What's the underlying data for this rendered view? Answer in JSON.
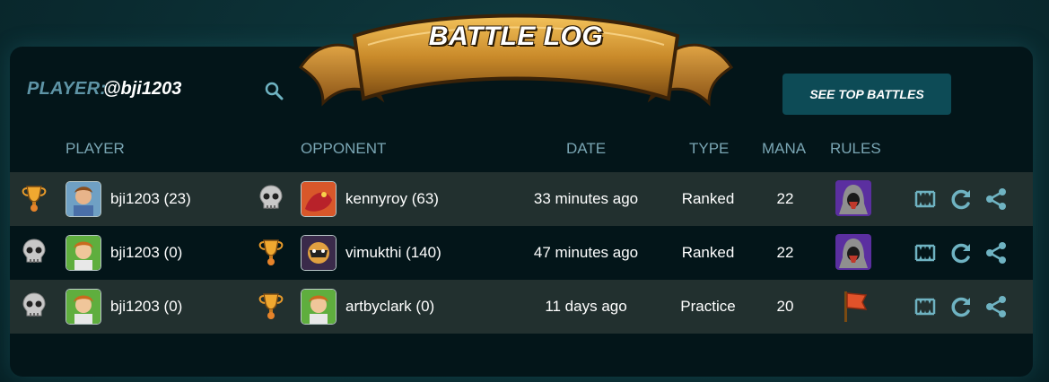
{
  "banner": {
    "title": "BATTLE LOG"
  },
  "player": {
    "label": "PLAYER:",
    "name": "@bji1203"
  },
  "top_battles_button": "SEE TOP BATTLES",
  "columns": {
    "player": "PLAYER",
    "opponent": "OPPONENT",
    "date": "DATE",
    "type": "TYPE",
    "mana": "MANA",
    "rules": "RULES"
  },
  "rows": [
    {
      "player_result": "trophy",
      "player": "bji1203 (23)",
      "opponent_result": "skull",
      "opponent": "kennyroy (63)",
      "date": "33 minutes ago",
      "type": "Ranked",
      "mana": "22",
      "rule_icon": "hooded-figure-icon"
    },
    {
      "player_result": "skull",
      "player": "bji1203 (0)",
      "opponent_result": "trophy",
      "opponent": "vimukthi (140)",
      "date": "47 minutes ago",
      "type": "Ranked",
      "mana": "22",
      "rule_icon": "hooded-figure-icon"
    },
    {
      "player_result": "skull",
      "player": "bji1203 (0)",
      "opponent_result": "trophy",
      "opponent": "artbyclark (0)",
      "date": "11 days ago",
      "type": "Practice",
      "mana": "20",
      "rule_icon": "flag-icon"
    }
  ],
  "colors": {
    "panel": "#031519",
    "row_alt": "#22302f",
    "header_text": "#7aa6b4",
    "accent_button": "#0d4b56",
    "icon": "#6fb3c2"
  }
}
